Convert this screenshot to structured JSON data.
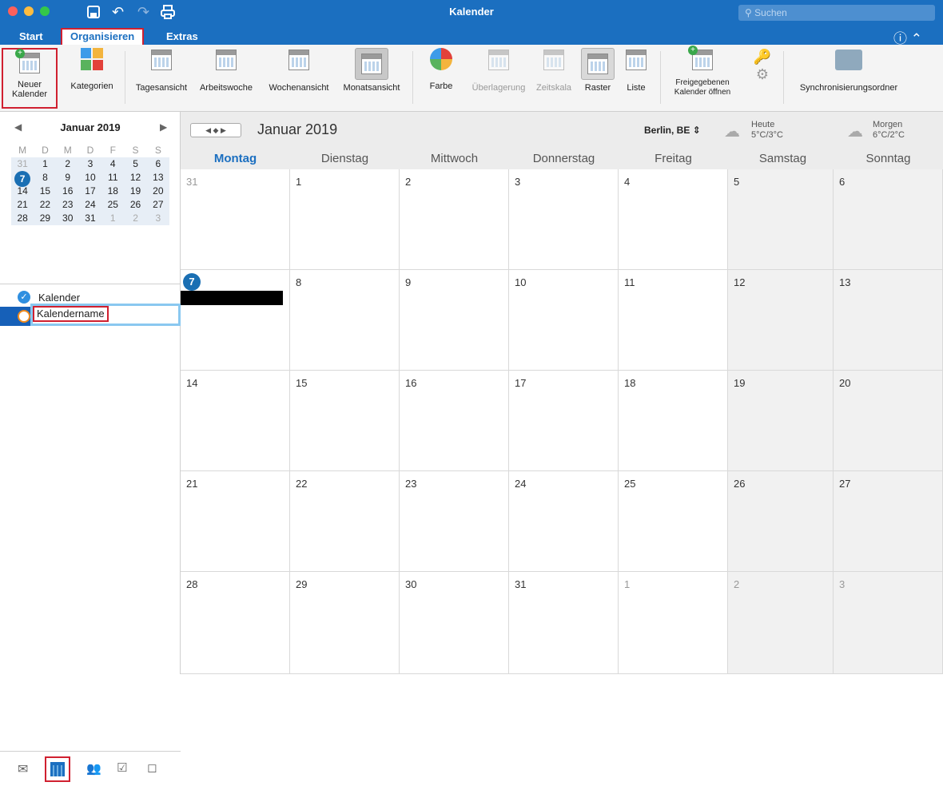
{
  "window": {
    "title": "Kalender",
    "search_placeholder": "Suchen"
  },
  "tabs": [
    {
      "label": "Start"
    },
    {
      "label": "Organisieren"
    },
    {
      "label": "Extras"
    }
  ],
  "ribbon": {
    "new_calendar": "Neuer Kalender",
    "categories": "Kategorien",
    "day_view": "Tagesansicht",
    "work_week": "Arbeitswoche",
    "week_view": "Wochenansicht",
    "month_view": "Monatsansicht",
    "color": "Farbe",
    "overlay": "Überlagerung",
    "timescale": "Zeitskala",
    "grid": "Raster",
    "list": "Liste",
    "open_shared": "Freigegebenen Kalender öffnen",
    "sync_folder": "Synchronisierungsordner"
  },
  "mini_calendar": {
    "title": "Januar 2019",
    "weekdays": [
      "M",
      "D",
      "M",
      "D",
      "F",
      "S",
      "S"
    ],
    "weeks": [
      [
        "31",
        "1",
        "2",
        "3",
        "4",
        "5",
        "6"
      ],
      [
        "7",
        "8",
        "9",
        "10",
        "11",
        "12",
        "13"
      ],
      [
        "14",
        "15",
        "16",
        "17",
        "18",
        "19",
        "20"
      ],
      [
        "21",
        "22",
        "23",
        "24",
        "25",
        "26",
        "27"
      ],
      [
        "28",
        "29",
        "30",
        "31",
        "1",
        "2",
        "3"
      ]
    ]
  },
  "calendars": {
    "item1": "Kalender",
    "item2": "Kalendername"
  },
  "main": {
    "title": "Januar 2019",
    "location": "Berlin, BE",
    "today_label": "Heute",
    "today_temp": "5°C/3°C",
    "tomorrow_label": "Morgen",
    "tomorrow_temp": "6°C/2°C",
    "days": [
      "Montag",
      "Dienstag",
      "Mittwoch",
      "Donnerstag",
      "Freitag",
      "Samstag",
      "Sonntag"
    ],
    "weeks": [
      [
        "31",
        "1",
        "2",
        "3",
        "4",
        "5",
        "6"
      ],
      [
        "7",
        "8",
        "9",
        "10",
        "11",
        "12",
        "13"
      ],
      [
        "14",
        "15",
        "16",
        "17",
        "18",
        "19",
        "20"
      ],
      [
        "21",
        "22",
        "23",
        "24",
        "25",
        "26",
        "27"
      ],
      [
        "28",
        "29",
        "30",
        "31",
        "1",
        "2",
        "3"
      ]
    ]
  },
  "colors": {
    "accent": "#1b6fc0",
    "highlight": "#d02030",
    "today": "#1a6fb3"
  }
}
